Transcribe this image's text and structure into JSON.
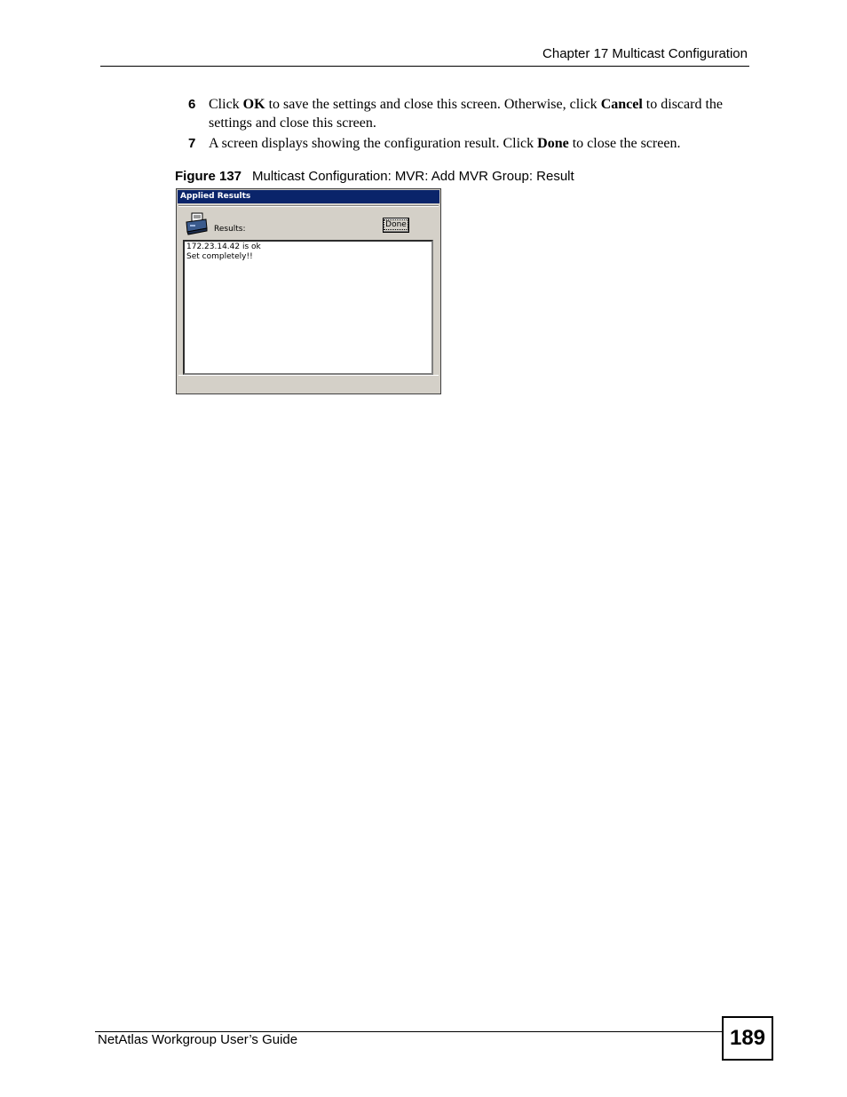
{
  "header": {
    "chapter": "Chapter 17 Multicast Configuration"
  },
  "steps": [
    {
      "number": "6",
      "parts": [
        "Click ",
        "OK",
        " to save the settings and close this screen. Otherwise, click ",
        "Cancel",
        " to discard the settings and close this screen."
      ]
    },
    {
      "number": "7",
      "parts": [
        "A screen displays showing the configuration result. Click ",
        "Done",
        " to close the screen."
      ]
    }
  ],
  "figure": {
    "label": "Figure 137",
    "title": "Multicast Configuration: MVR: Add MVR Group: Result"
  },
  "dialog": {
    "title": "Applied Results",
    "results_label": "Results:",
    "done_button": "Done",
    "result_lines": [
      "172.23.14.42 is ok",
      "Set completely!!"
    ],
    "icon": "printer-icon"
  },
  "footer": {
    "guide_title": "NetAtlas Workgroup User’s Guide",
    "page_number": "189"
  }
}
